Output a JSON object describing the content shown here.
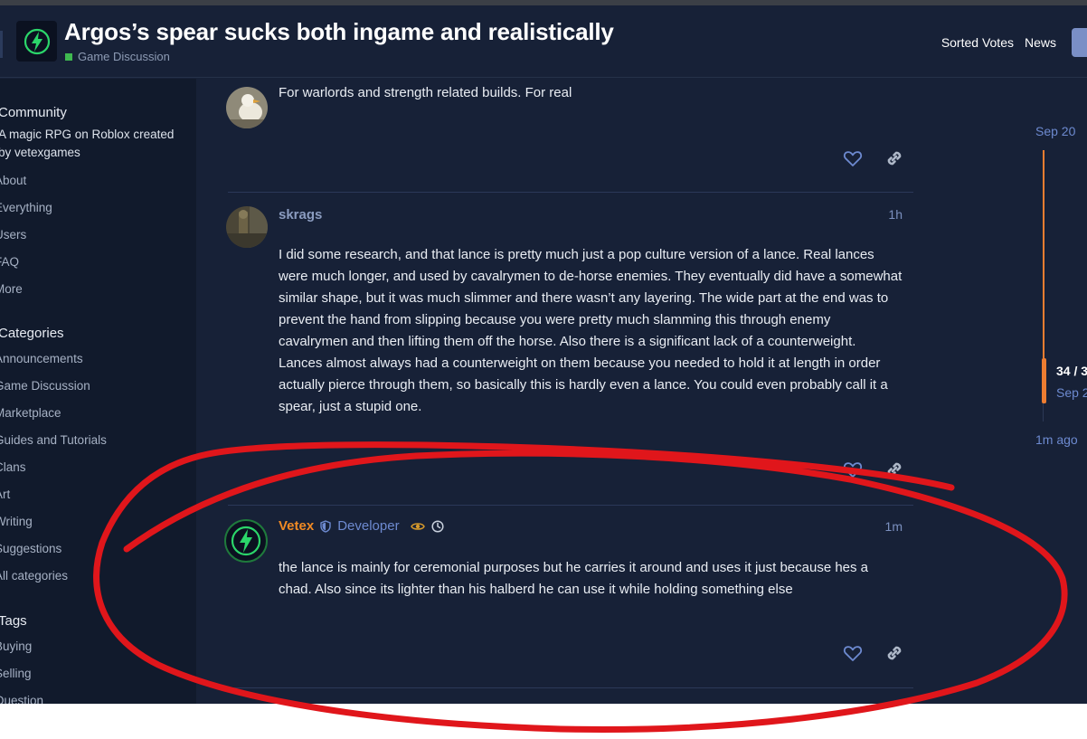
{
  "header": {
    "title": "Argos’s spear sucks both ingame and realistically",
    "category": "Game Discussion",
    "nav": [
      "Sorted Votes",
      "News"
    ]
  },
  "sidebar": {
    "community_heading": "Community",
    "community_desc": "A magic RPG on Roblox created by vetexgames",
    "links": [
      "About",
      "Everything",
      "Users",
      "FAQ",
      "More"
    ],
    "categories_heading": "Categories",
    "categories": [
      "Announcements",
      "Game Discussion",
      "Marketplace",
      "Guides and Tutorials",
      "Clans",
      "Art",
      "Writing",
      "Suggestions",
      "All categories"
    ],
    "tags_heading": "Tags",
    "tags": [
      "Buying",
      "Selling",
      "Question"
    ]
  },
  "posts": [
    {
      "body": "For warlords and strength related builds. For real"
    },
    {
      "username": "skrags",
      "time": "1h",
      "body": "I did some research, and that lance is pretty much just a pop culture version of a lance. Real lances were much longer, and used by cavalrymen to de-horse enemies. They eventually did have a somewhat similar shape, but it was much slimmer and there wasn’t any layering. The wide part at the end was to prevent the hand from slipping because you were pretty much slamming this through enemy cavalrymen and then lifting them off the horse. Also there is a significant lack of a counterweight. Lances almost always had a counterweight on them because you needed to hold it at length in order actually pierce through them, so basically this is hardly even a lance. You could even probably call it a spear, just a stupid one."
    },
    {
      "username": "Vetex",
      "title": "Developer",
      "time": "1m",
      "body": "the lance is mainly for ceremonial purposes but he carries it around and uses it just because hes a chad. Also since its lighter than his halberd he can use it while holding something else"
    }
  ],
  "timeline": {
    "top_date": "Sep 20",
    "count": "34 / 3",
    "sub_date": "Sep 2",
    "bottom": "1m ago"
  },
  "colors": {
    "background": "#172137",
    "sidebar": "#111a2c",
    "accent": "#6d8ad0",
    "timeline": "#ed7d31",
    "developer_name": "#f08a24",
    "annotation": "#e0161b"
  }
}
